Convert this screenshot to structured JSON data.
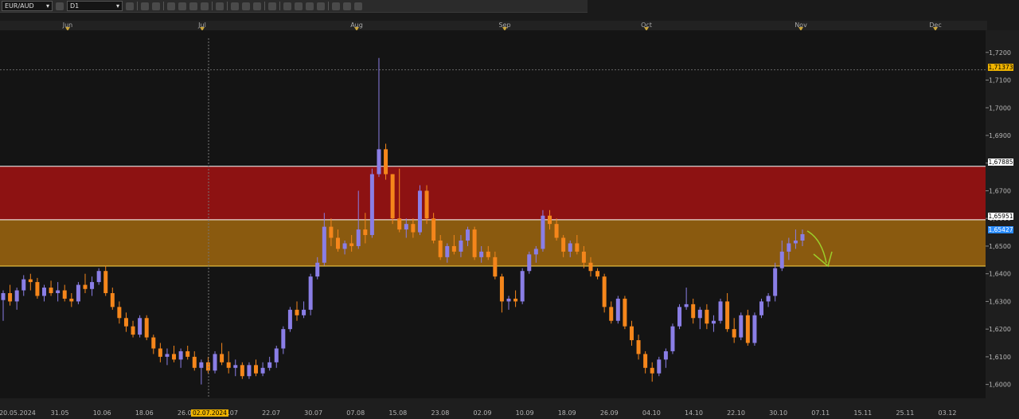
{
  "toolbar": {
    "symbol": "EUR/AUD",
    "timeframe": "D1",
    "icons": [
      "line-chart-icon",
      "candle-style-icon",
      "zoom-in-icon",
      "zoom-out-icon",
      "crosshair-icon",
      "draw-text-icon",
      "settings-icon",
      "globe-icon",
      "pencil-icon",
      "image-icon",
      "tools-icon",
      "list-icon",
      "check-icon",
      "circle-icon",
      "eraser-icon",
      "grid-icon"
    ]
  },
  "months": [
    "Jun",
    "Jul",
    "Aug",
    "Sep",
    "Oct",
    "Nov",
    "Dec"
  ],
  "price_tags": {
    "high_marker": "1,71373",
    "zone_top": "1,67885",
    "zone_mid": "1,65951",
    "current": "1,65427"
  },
  "cursor_date": "02.07.2024",
  "colors": {
    "background": "#141414",
    "bull": "#8a7ee6",
    "bear": "#f5861b",
    "zone_red": "#8d1212",
    "zone_orange": "#8a5a0f",
    "arrow": "#9ccc2a",
    "tag_gold": "#f0b400",
    "tag_blue": "#2a8cff"
  },
  "chart_data": {
    "type": "candlestick",
    "symbol": "EUR/AUD",
    "timeframe": "D1",
    "ylim": [
      1.595,
      1.728
    ],
    "y_ticks": [
      "1,6000",
      "1,6100",
      "1,6200",
      "1,6300",
      "1,6400",
      "1,6500",
      "1,6600",
      "1,6700",
      "1,6800",
      "1,6900",
      "1,7000",
      "1,7100",
      "1,7200"
    ],
    "x_ticks": [
      "20.05.2024",
      "31.05",
      "10.06",
      "18.06",
      "26.06",
      "12.07",
      "22.07",
      "30.07",
      "07.08",
      "15.08",
      "23.08",
      "02.09",
      "10.09",
      "18.09",
      "26.09",
      "04.10",
      "14.10",
      "22.10",
      "30.10",
      "07.11",
      "15.11",
      "25.11",
      "03.12"
    ],
    "zones": [
      {
        "from": 1.65951,
        "to": 1.67885,
        "color": "red"
      },
      {
        "from": 1.6428,
        "to": 1.65951,
        "color": "orange"
      }
    ],
    "horizontal_lines": [
      1.71373
    ],
    "candles": [
      [
        1.6305,
        1.634,
        1.623,
        1.633
      ],
      [
        1.633,
        1.636,
        1.6285,
        1.63
      ],
      [
        1.63,
        1.635,
        1.627,
        1.634
      ],
      [
        1.634,
        1.6395,
        1.632,
        1.638
      ],
      [
        1.638,
        1.64,
        1.634,
        1.637
      ],
      [
        1.637,
        1.6385,
        1.631,
        1.632
      ],
      [
        1.632,
        1.636,
        1.63,
        1.635
      ],
      [
        1.635,
        1.6375,
        1.632,
        1.633
      ],
      [
        1.633,
        1.637,
        1.63,
        1.634
      ],
      [
        1.634,
        1.636,
        1.63,
        1.631
      ],
      [
        1.631,
        1.633,
        1.628,
        1.63
      ],
      [
        1.63,
        1.637,
        1.629,
        1.636
      ],
      [
        1.636,
        1.64,
        1.633,
        1.6345
      ],
      [
        1.6345,
        1.639,
        1.632,
        1.637
      ],
      [
        1.637,
        1.642,
        1.636,
        1.641
      ],
      [
        1.641,
        1.643,
        1.632,
        1.633
      ],
      [
        1.633,
        1.635,
        1.627,
        1.628
      ],
      [
        1.628,
        1.63,
        1.622,
        1.624
      ],
      [
        1.624,
        1.626,
        1.619,
        1.621
      ],
      [
        1.621,
        1.623,
        1.617,
        1.618
      ],
      [
        1.618,
        1.625,
        1.617,
        1.624
      ],
      [
        1.624,
        1.625,
        1.616,
        1.617
      ],
      [
        1.617,
        1.618,
        1.611,
        1.613
      ],
      [
        1.613,
        1.615,
        1.608,
        1.61
      ],
      [
        1.61,
        1.613,
        1.607,
        1.611
      ],
      [
        1.611,
        1.614,
        1.608,
        1.609
      ],
      [
        1.609,
        1.613,
        1.606,
        1.612
      ],
      [
        1.612,
        1.614,
        1.609,
        1.61
      ],
      [
        1.61,
        1.612,
        1.605,
        1.606
      ],
      [
        1.606,
        1.609,
        1.6,
        1.608
      ],
      [
        1.608,
        1.61,
        1.604,
        1.605
      ],
      [
        1.605,
        1.612,
        1.604,
        1.611
      ],
      [
        1.611,
        1.615,
        1.607,
        1.608
      ],
      [
        1.608,
        1.612,
        1.604,
        1.606
      ],
      [
        1.606,
        1.609,
        1.603,
        1.607
      ],
      [
        1.607,
        1.608,
        1.602,
        1.603
      ],
      [
        1.603,
        1.608,
        1.602,
        1.607
      ],
      [
        1.607,
        1.609,
        1.603,
        1.604
      ],
      [
        1.604,
        1.608,
        1.603,
        1.606
      ],
      [
        1.606,
        1.61,
        1.605,
        1.608
      ],
      [
        1.608,
        1.614,
        1.606,
        1.613
      ],
      [
        1.613,
        1.621,
        1.611,
        1.62
      ],
      [
        1.62,
        1.628,
        1.619,
        1.627
      ],
      [
        1.627,
        1.63,
        1.623,
        1.625
      ],
      [
        1.625,
        1.63,
        1.624,
        1.627
      ],
      [
        1.627,
        1.64,
        1.625,
        1.639
      ],
      [
        1.639,
        1.646,
        1.638,
        1.644
      ],
      [
        1.644,
        1.662,
        1.643,
        1.657
      ],
      [
        1.657,
        1.66,
        1.65,
        1.653
      ],
      [
        1.653,
        1.656,
        1.648,
        1.649
      ],
      [
        1.649,
        1.652,
        1.647,
        1.651
      ],
      [
        1.651,
        1.654,
        1.648,
        1.65
      ],
      [
        1.65,
        1.67,
        1.649,
        1.656
      ],
      [
        1.656,
        1.662,
        1.651,
        1.654
      ],
      [
        1.654,
        1.678,
        1.653,
        1.676
      ],
      [
        1.676,
        1.718,
        1.675,
        1.685
      ],
      [
        1.685,
        1.687,
        1.674,
        1.676
      ],
      [
        1.676,
        1.676,
        1.658,
        1.66
      ],
      [
        1.66,
        1.678,
        1.655,
        1.656
      ],
      [
        1.656,
        1.66,
        1.653,
        1.658
      ],
      [
        1.658,
        1.66,
        1.653,
        1.655
      ],
      [
        1.655,
        1.672,
        1.654,
        1.67
      ],
      [
        1.67,
        1.672,
        1.658,
        1.66
      ],
      [
        1.66,
        1.662,
        1.651,
        1.652
      ],
      [
        1.652,
        1.654,
        1.645,
        1.646
      ],
      [
        1.646,
        1.651,
        1.644,
        1.65
      ],
      [
        1.65,
        1.654,
        1.647,
        1.648
      ],
      [
        1.648,
        1.654,
        1.646,
        1.652
      ],
      [
        1.652,
        1.657,
        1.65,
        1.656
      ],
      [
        1.656,
        1.657,
        1.645,
        1.646
      ],
      [
        1.646,
        1.65,
        1.644,
        1.648
      ],
      [
        1.648,
        1.65,
        1.645,
        1.646
      ],
      [
        1.646,
        1.648,
        1.638,
        1.639
      ],
      [
        1.639,
        1.64,
        1.626,
        1.63
      ],
      [
        1.63,
        1.632,
        1.627,
        1.631
      ],
      [
        1.631,
        1.634,
        1.628,
        1.63
      ],
      [
        1.63,
        1.642,
        1.629,
        1.641
      ],
      [
        1.641,
        1.648,
        1.64,
        1.647
      ],
      [
        1.647,
        1.65,
        1.644,
        1.649
      ],
      [
        1.649,
        1.663,
        1.648,
        1.661
      ],
      [
        1.661,
        1.663,
        1.656,
        1.658
      ],
      [
        1.658,
        1.66,
        1.652,
        1.653
      ],
      [
        1.653,
        1.654,
        1.646,
        1.648
      ],
      [
        1.648,
        1.652,
        1.646,
        1.651
      ],
      [
        1.651,
        1.654,
        1.647,
        1.648
      ],
      [
        1.648,
        1.65,
        1.642,
        1.644
      ],
      [
        1.644,
        1.646,
        1.639,
        1.641
      ],
      [
        1.641,
        1.642,
        1.638,
        1.639
      ],
      [
        1.639,
        1.64,
        1.626,
        1.628
      ],
      [
        1.628,
        1.63,
        1.622,
        1.623
      ],
      [
        1.623,
        1.632,
        1.622,
        1.631
      ],
      [
        1.631,
        1.632,
        1.62,
        1.621
      ],
      [
        1.621,
        1.623,
        1.614,
        1.616
      ],
      [
        1.616,
        1.618,
        1.609,
        1.611
      ],
      [
        1.611,
        1.612,
        1.604,
        1.606
      ],
      [
        1.606,
        1.608,
        1.601,
        1.604
      ],
      [
        1.604,
        1.61,
        1.603,
        1.609
      ],
      [
        1.609,
        1.613,
        1.606,
        1.612
      ],
      [
        1.612,
        1.622,
        1.611,
        1.621
      ],
      [
        1.621,
        1.629,
        1.62,
        1.628
      ],
      [
        1.628,
        1.635,
        1.627,
        1.629
      ],
      [
        1.629,
        1.631,
        1.622,
        1.624
      ],
      [
        1.624,
        1.628,
        1.62,
        1.627
      ],
      [
        1.627,
        1.629,
        1.62,
        1.622
      ],
      [
        1.622,
        1.625,
        1.619,
        1.623
      ],
      [
        1.623,
        1.631,
        1.622,
        1.63
      ],
      [
        1.63,
        1.633,
        1.619,
        1.62
      ],
      [
        1.62,
        1.624,
        1.615,
        1.617
      ],
      [
        1.617,
        1.626,
        1.616,
        1.625
      ],
      [
        1.625,
        1.627,
        1.614,
        1.615
      ],
      [
        1.615,
        1.626,
        1.614,
        1.625
      ],
      [
        1.625,
        1.631,
        1.624,
        1.63
      ],
      [
        1.63,
        1.633,
        1.628,
        1.632
      ],
      [
        1.632,
        1.644,
        1.63,
        1.642
      ],
      [
        1.642,
        1.652,
        1.641,
        1.648
      ],
      [
        1.648,
        1.653,
        1.645,
        1.651
      ],
      [
        1.651,
        1.656,
        1.649,
        1.652
      ],
      [
        1.652,
        1.656,
        1.65,
        1.6543
      ]
    ],
    "annotations": [
      {
        "type": "arrow",
        "direction": "down",
        "color": "green"
      }
    ]
  }
}
